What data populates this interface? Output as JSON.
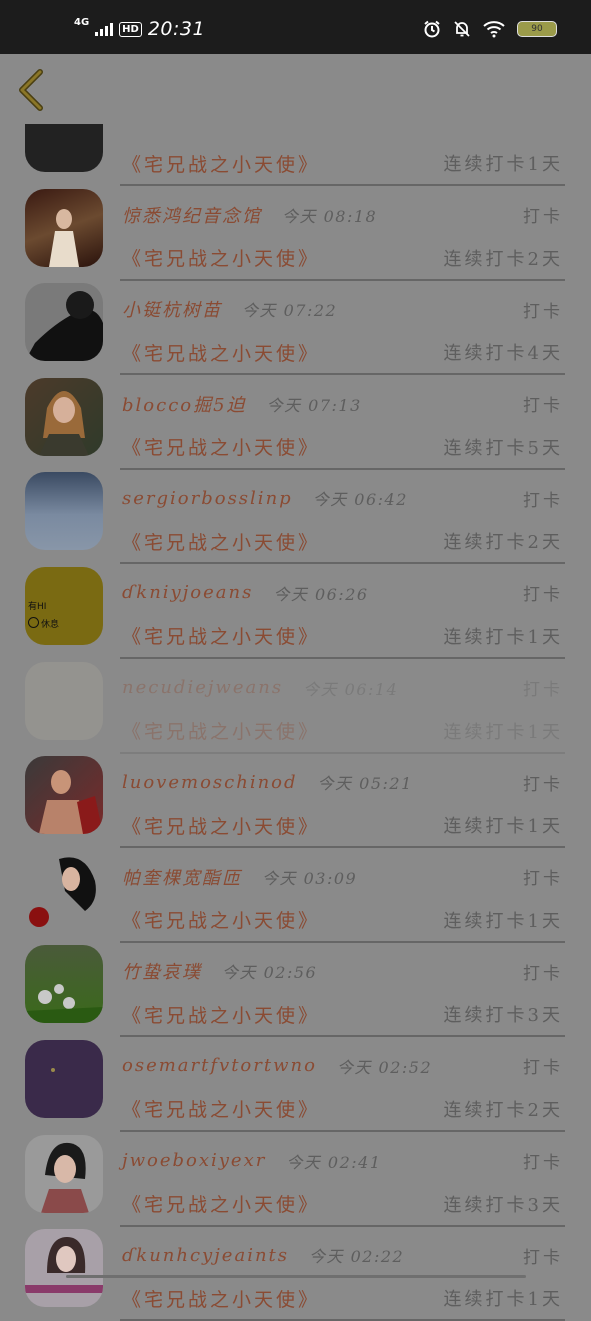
{
  "status_bar": {
    "network": "4G",
    "hd": "HD",
    "time": "20:31",
    "battery": "90"
  },
  "top_bar": {
    "back_icon": "chevron-left-icon",
    "accent": "#6b5a1c"
  },
  "rows": [
    {
      "name": "",
      "time": "",
      "checkin": "",
      "book": "《宅兄战之小天使》",
      "streak": "连续打卡1天",
      "faded": false
    },
    {
      "name": "惊悉鸿纪音念馆",
      "time": "今天 08:18",
      "checkin": "打卡",
      "book": "《宅兄战之小天使》",
      "streak": "连续打卡2天",
      "faded": false
    },
    {
      "name": "小铤杭树苗",
      "time": "今天 07:22",
      "checkin": "打卡",
      "book": "《宅兄战之小天使》",
      "streak": "连续打卡4天",
      "faded": false
    },
    {
      "name": "blocco掘5迫",
      "time": "今天 07:13",
      "checkin": "打卡",
      "book": "《宅兄战之小天使》",
      "streak": "连续打卡5天",
      "faded": false
    },
    {
      "name": "sergiorbosslinp",
      "time": "今天 06:42",
      "checkin": "打卡",
      "book": "《宅兄战之小天使》",
      "streak": "连续打卡2天",
      "faded": false
    },
    {
      "name": "ɗkniyjoeans",
      "time": "今天 06:26",
      "checkin": "打卡",
      "book": "《宅兄战之小天使》",
      "streak": "连续打卡1天",
      "faded": false
    },
    {
      "name": "necudiejweans",
      "time": "今天 06:14",
      "checkin": "打卡",
      "book": "《宅兄战之小天使》",
      "streak": "连续打卡1天",
      "faded": true
    },
    {
      "name": "luovemoschinod",
      "time": "今天 05:21",
      "checkin": "打卡",
      "book": "《宅兄战之小天使》",
      "streak": "连续打卡1天",
      "faded": false
    },
    {
      "name": "帕奎棵宽酯匝",
      "time": "今天 03:09",
      "checkin": "打卡",
      "book": "《宅兄战之小天使》",
      "streak": "连续打卡1天",
      "faded": false
    },
    {
      "name": "竹蛰哀璞",
      "time": "今天 02:56",
      "checkin": "打卡",
      "book": "《宅兄战之小天使》",
      "streak": "连续打卡3天",
      "faded": false
    },
    {
      "name": "osemartfvtortwno",
      "time": "今天 02:52",
      "checkin": "打卡",
      "book": "《宅兄战之小天使》",
      "streak": "连续打卡2天",
      "faded": false
    },
    {
      "name": "jwoeboxiyexr",
      "time": "今天 02:41",
      "checkin": "打卡",
      "book": "《宅兄战之小天使》",
      "streak": "连续打卡3天",
      "faded": false
    },
    {
      "name": "ɗkunhcyjeaints",
      "time": "今天 02:22",
      "checkin": "打卡",
      "book": "《宅兄战之小天使》",
      "streak": "连续打卡1天",
      "faded": false
    }
  ],
  "avatar_texts": {
    "yellow_line1": "有HI",
    "yellow_line2": "休息"
  }
}
